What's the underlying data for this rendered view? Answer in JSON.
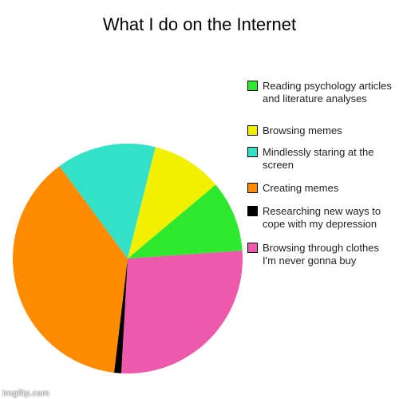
{
  "chart_data": {
    "type": "pie",
    "title": "What I do on the Internet",
    "start_angle_deg": 86,
    "slices": [
      {
        "label": "Browsing through clothes I'm never gonna buy",
        "value": 27,
        "color": "#ed5aab"
      },
      {
        "label": "Researching new ways to cope with my depression",
        "value": 1,
        "color": "#000000"
      },
      {
        "label": "Creating memes",
        "value": 38,
        "color": "#ff8c00"
      },
      {
        "label": "Mindlessly staring at the screen",
        "value": 14,
        "color": "#33e0c8"
      },
      {
        "label": "Browsing memes",
        "value": 10,
        "color": "#f0f000"
      },
      {
        "label": "Reading psychology articles and literature analyses",
        "value": 10,
        "color": "#2ee82e"
      }
    ],
    "legend": {
      "placement": "right",
      "entries": [
        {
          "label": "Reading psychology articles and literature analyses",
          "color": "#2ee82e"
        },
        {
          "label": "Browsing memes",
          "color": "#f0f000"
        },
        {
          "label": "Mindlessly staring at the screen",
          "color": "#33e0c8"
        },
        {
          "label": "Creating memes",
          "color": "#ff8c00"
        },
        {
          "label": "Researching new ways to cope with my depression",
          "color": "#000000"
        },
        {
          "label": "Browsing through clothes I'm never gonna buy",
          "color": "#ed5aab"
        }
      ]
    }
  },
  "watermark": "imgflip.com"
}
